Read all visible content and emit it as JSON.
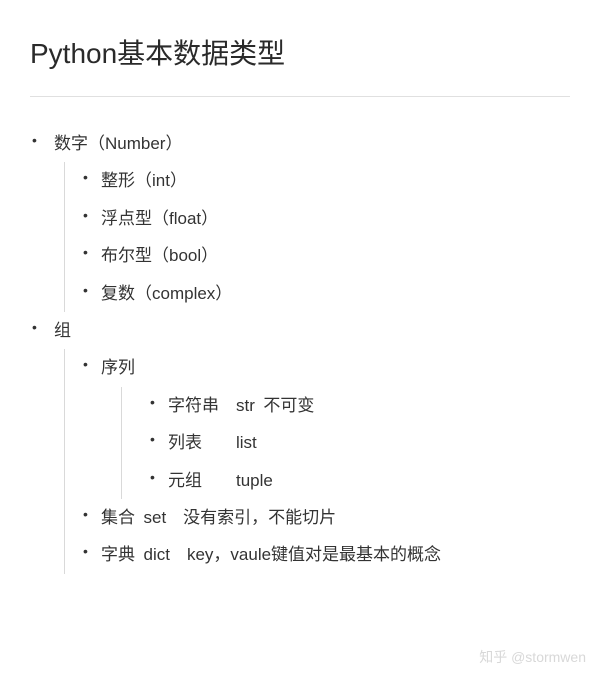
{
  "title": "Python基本数据类型",
  "list": {
    "item0": {
      "label": "数字（Number）",
      "children": {
        "c0": "整形（int）",
        "c1": "浮点型（float）",
        "c2": "布尔型（bool）",
        "c3": "复数（complex）"
      }
    },
    "item1": {
      "label": "组",
      "children": {
        "c0": {
          "label": "序列",
          "children": {
            "s0": "字符串 str 不可变",
            "s1": "列表  list",
            "s2": "元组  tuple"
          }
        },
        "c1": "集合 set 没有索引，不能切片",
        "c2": "字典 dict key，vaule键值对是最基本的概念"
      }
    }
  },
  "watermark": "知乎 @stormwen"
}
